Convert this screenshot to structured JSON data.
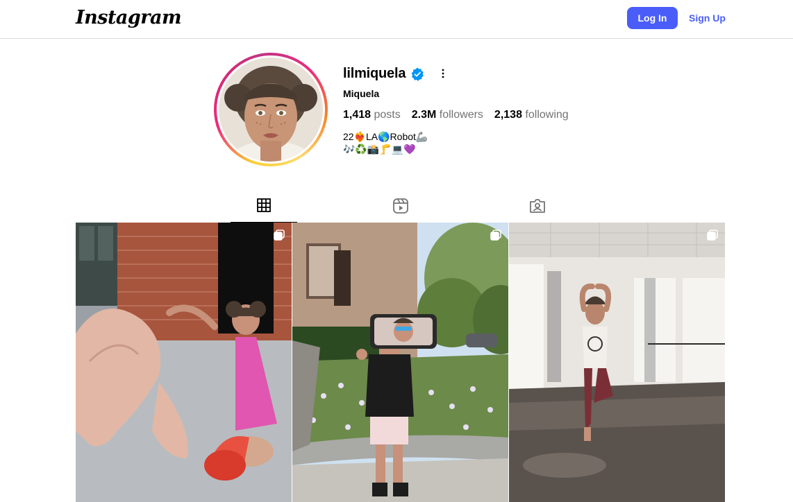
{
  "header": {
    "logo": "Instagram",
    "login_label": "Log In",
    "signup_label": "Sign Up",
    "accent": "#4a5df9"
  },
  "profile": {
    "username": "lilmiquela",
    "verified_icon": "verified-badge-icon",
    "more_icon": "more-options-icon",
    "full_name": "Miquela",
    "stats": {
      "posts_count": "1,418",
      "posts_label": "posts",
      "followers_count": "2.3M",
      "followers_label": "followers",
      "following_count": "2,138",
      "following_label": "following"
    },
    "bio_line1": "22❤️‍🔥LA🌎Robot🦾",
    "bio_line2": "🎶♻️📸🦵💻💜"
  },
  "tabs": [
    {
      "icon": "grid-icon",
      "active": true
    },
    {
      "icon": "reels-icon",
      "active": false
    },
    {
      "icon": "tagged-icon",
      "active": false
    }
  ],
  "posts": [
    {
      "icon": "carousel-icon"
    },
    {
      "icon": "carousel-icon"
    },
    {
      "icon": "carousel-icon"
    }
  ]
}
